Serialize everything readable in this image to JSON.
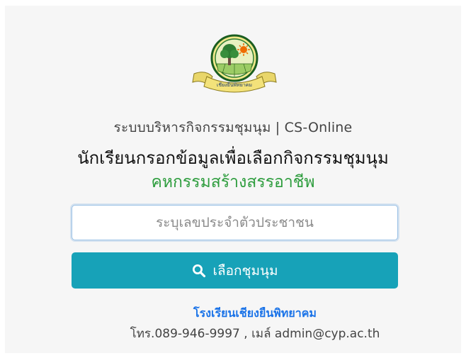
{
  "logo": {
    "alt_icon": "school-emblem",
    "banner_text": "เชียงยืนพิทยาคม"
  },
  "header": {
    "system_title": "ระบบบริหารกิจกรรมชุมนุม | CS-Online",
    "main_heading": "นักเรียนกรอกข้อมูลเพื่อเลือกกิจกรรมชุมนุม",
    "club_name": "คหกรรมสร้างสรรอาชีพ"
  },
  "form": {
    "id_placeholder": "ระบุเลขประจำตัวประชาชน",
    "id_value": "",
    "submit_icon": "search-icon",
    "submit_label": "เลือกชุมนุม"
  },
  "footer": {
    "school_name": "โรงเรียนเชียงยืนพิทยาคม",
    "contact": "โทร.089-946-9997 , เมล์ admin@cyp.ac.th"
  },
  "colors": {
    "club_green": "#2e9d3e",
    "button_teal": "#17a2b8",
    "link_blue": "#1a73e8"
  }
}
